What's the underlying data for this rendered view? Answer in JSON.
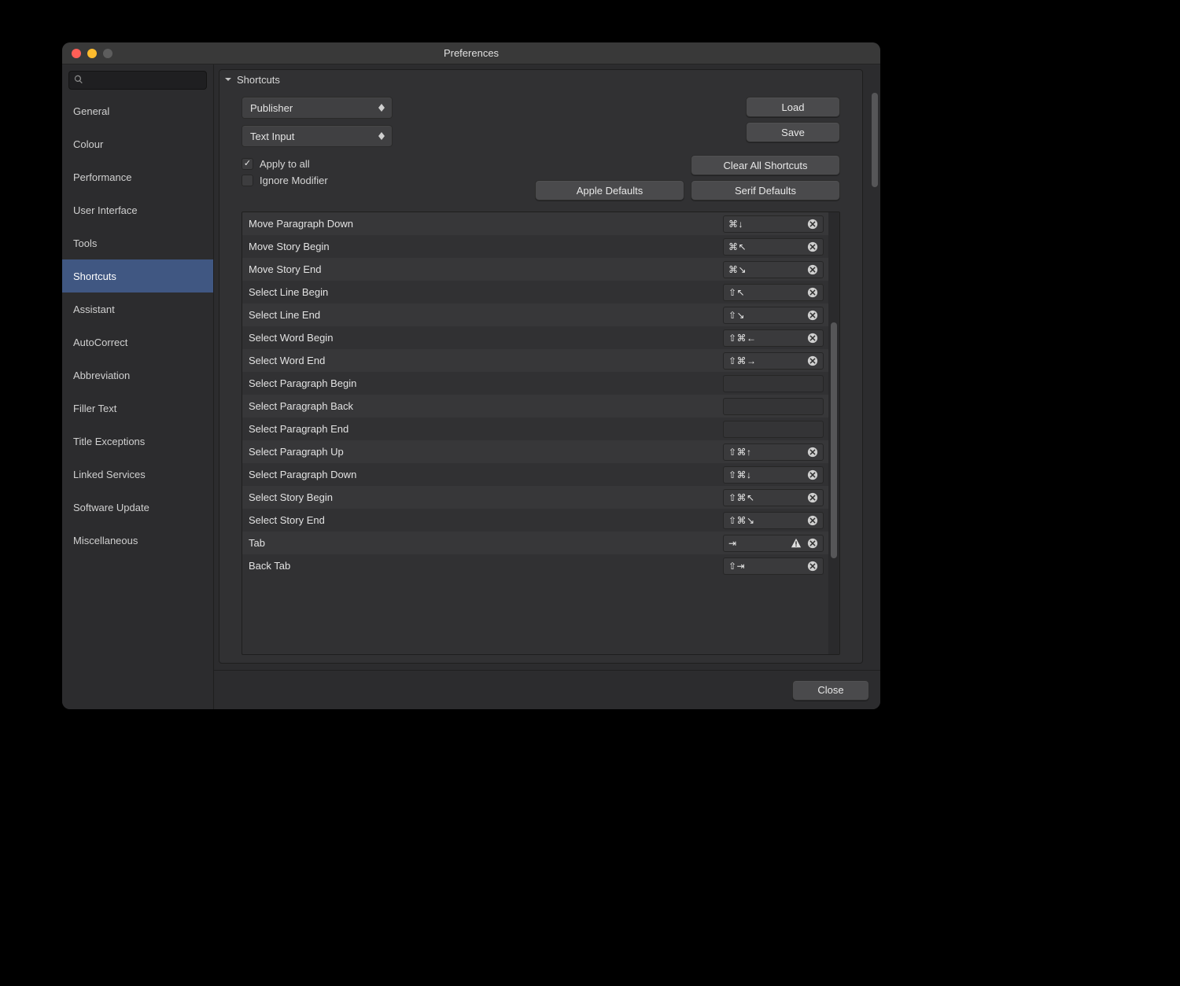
{
  "window": {
    "title": "Preferences"
  },
  "search": {
    "placeholder": ""
  },
  "sidebar": {
    "items": [
      {
        "label": "General",
        "selected": false
      },
      {
        "label": "Colour",
        "selected": false
      },
      {
        "label": "Performance",
        "selected": false
      },
      {
        "label": "User Interface",
        "selected": false
      },
      {
        "label": "Tools",
        "selected": false
      },
      {
        "label": "Shortcuts",
        "selected": true
      },
      {
        "label": "Assistant",
        "selected": false
      },
      {
        "label": "AutoCorrect",
        "selected": false
      },
      {
        "label": "Abbreviation",
        "selected": false
      },
      {
        "label": "Filler Text",
        "selected": false
      },
      {
        "label": "Title Exceptions",
        "selected": false
      },
      {
        "label": "Linked Services",
        "selected": false
      },
      {
        "label": "Software Update",
        "selected": false
      },
      {
        "label": "Miscellaneous",
        "selected": false
      }
    ]
  },
  "panel": {
    "title": "Shortcuts",
    "select_app": "Publisher",
    "select_context": "Text Input",
    "load": "Load",
    "save": "Save",
    "apply_all_label": "Apply to all",
    "apply_all_checked": true,
    "ignore_modifier_label": "Ignore Modifier",
    "ignore_modifier_checked": false,
    "clear_all": "Clear All Shortcuts",
    "apple_defaults": "Apple Defaults",
    "serif_defaults": "Serif Defaults"
  },
  "shortcuts": [
    {
      "label": "Move Paragraph Down",
      "keys": "⌘↓",
      "clearable": true,
      "warn": false
    },
    {
      "label": "Move Story Begin",
      "keys": "⌘↖",
      "clearable": true,
      "warn": false
    },
    {
      "label": "Move Story End",
      "keys": "⌘↘",
      "clearable": true,
      "warn": false
    },
    {
      "label": "Select Line Begin",
      "keys": "⇧↖",
      "clearable": true,
      "warn": false
    },
    {
      "label": "Select Line End",
      "keys": "⇧↘",
      "clearable": true,
      "warn": false
    },
    {
      "label": "Select Word Begin",
      "keys": "⇧⌘←",
      "clearable": true,
      "warn": false
    },
    {
      "label": "Select Word End",
      "keys": "⇧⌘→",
      "clearable": true,
      "warn": false
    },
    {
      "label": "Select Paragraph Begin",
      "keys": "",
      "clearable": false,
      "warn": false
    },
    {
      "label": "Select Paragraph Back",
      "keys": "",
      "clearable": false,
      "warn": false
    },
    {
      "label": "Select Paragraph End",
      "keys": "",
      "clearable": false,
      "warn": false
    },
    {
      "label": "Select Paragraph Up",
      "keys": "⇧⌘↑",
      "clearable": true,
      "warn": false
    },
    {
      "label": "Select Paragraph Down",
      "keys": "⇧⌘↓",
      "clearable": true,
      "warn": false
    },
    {
      "label": "Select Story Begin",
      "keys": "⇧⌘↖",
      "clearable": true,
      "warn": false
    },
    {
      "label": "Select Story End",
      "keys": "⇧⌘↘",
      "clearable": true,
      "warn": false
    },
    {
      "label": "Tab",
      "keys": "⇥",
      "clearable": true,
      "warn": true
    },
    {
      "label": "Back Tab",
      "keys": "⇧⇥",
      "clearable": true,
      "warn": false
    }
  ],
  "footer": {
    "close": "Close"
  }
}
